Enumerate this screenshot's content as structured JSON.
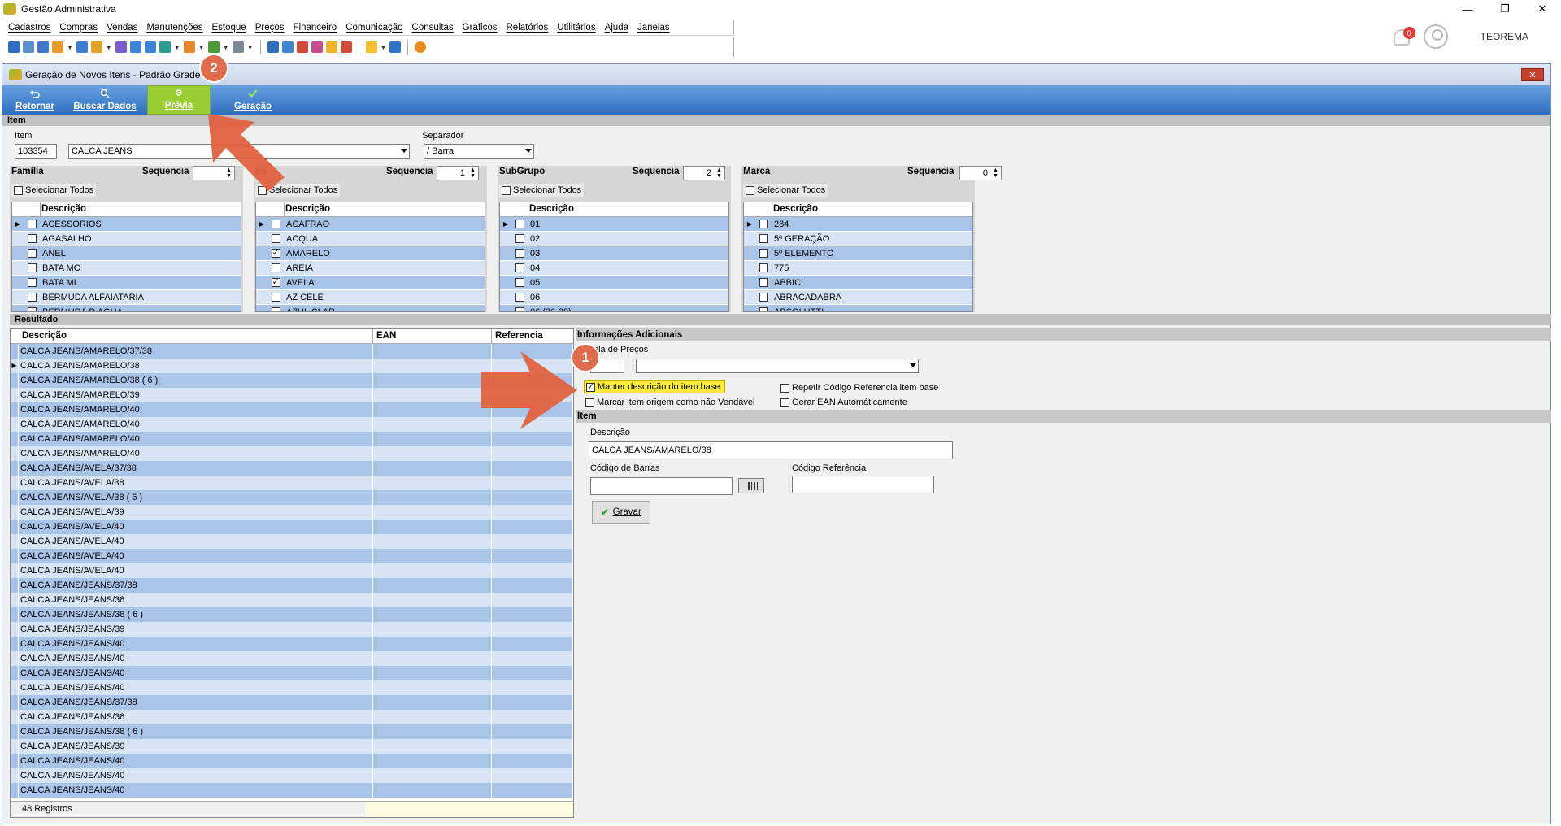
{
  "window": {
    "title": "Gestão Administrativa"
  },
  "menu": [
    "Cadastros",
    "Compras",
    "Vendas",
    "Manutenções",
    "Estoque",
    "Preços",
    "Financeiro",
    "Comunicação",
    "Consultas",
    "Gráficos",
    "Relatórios",
    "Utilitários",
    "Ajuda",
    "Janelas"
  ],
  "notifications": {
    "count": "0"
  },
  "user": {
    "name": "TEOREMA"
  },
  "child": {
    "title": "Geração de Novos Itens - Padrão Grade"
  },
  "ribbon": {
    "retornar": "Retornar",
    "buscar": "Buscar Dados",
    "previa": "Prévia",
    "geracao": "Geração"
  },
  "item_section": {
    "bar": "Item",
    "item_label": "Item",
    "code": "103354",
    "desc": "CALCA JEANS",
    "separador_label": "Separador",
    "separador": "/ Barra"
  },
  "filters": {
    "select_all": "Selecionar Todos",
    "col": "Descrição",
    "seq_label": "Sequencia",
    "familia": {
      "title": "Família",
      "seq": "",
      "rows": [
        {
          "t": "ACESSORIOS",
          "c": false,
          "cur": true
        },
        {
          "t": "AGASALHO",
          "c": false
        },
        {
          "t": "ANEL",
          "c": false
        },
        {
          "t": "BATA MC",
          "c": false
        },
        {
          "t": "BATA ML",
          "c": false
        },
        {
          "t": "BERMUDA ALFAIATARIA",
          "c": false
        },
        {
          "t": "BERMUDA D AGUA",
          "c": false
        }
      ]
    },
    "grupo": {
      "title": "po",
      "seq": "1",
      "rows": [
        {
          "t": "ACAFRAO",
          "c": false,
          "cur": true
        },
        {
          "t": "ACQUA",
          "c": false
        },
        {
          "t": "AMARELO",
          "c": true
        },
        {
          "t": "AREIA",
          "c": false
        },
        {
          "t": "AVELA",
          "c": true
        },
        {
          "t": "AZ CELE",
          "c": false
        },
        {
          "t": "AZUL CLAR",
          "c": false
        }
      ]
    },
    "subgrupo": {
      "title": "SubGrupo",
      "seq": "2",
      "rows": [
        {
          "t": "01",
          "c": false,
          "cur": true
        },
        {
          "t": "02",
          "c": false
        },
        {
          "t": "03",
          "c": false
        },
        {
          "t": "04",
          "c": false
        },
        {
          "t": "05",
          "c": false
        },
        {
          "t": "06",
          "c": false
        },
        {
          "t": "06 (36-38)",
          "c": false
        }
      ]
    },
    "marca": {
      "title": "Marca",
      "seq": "0",
      "rows": [
        {
          "t": "284",
          "c": false,
          "cur": true
        },
        {
          "t": "5ª GERAÇÃO",
          "c": false
        },
        {
          "t": "5º ELEMENTO",
          "c": false
        },
        {
          "t": "775",
          "c": false
        },
        {
          "t": "ABBICI",
          "c": false
        },
        {
          "t": "ABRACADABRA",
          "c": false
        },
        {
          "t": "ABSOLUTTI",
          "c": false
        }
      ]
    }
  },
  "resultado": {
    "bar": "Resultado",
    "headers": [
      "Descrição",
      "EAN",
      "Referencia"
    ],
    "rows": [
      "CALCA JEANS/AMARELO/37/38",
      "CALCA JEANS/AMARELO/38",
      "CALCA JEANS/AMARELO/38 ( 6 )",
      "CALCA JEANS/AMARELO/39",
      "CALCA JEANS/AMARELO/40",
      "CALCA JEANS/AMARELO/40",
      "CALCA JEANS/AMARELO/40",
      "CALCA JEANS/AMARELO/40",
      "CALCA JEANS/AVELA/37/38",
      "CALCA JEANS/AVELA/38",
      "CALCA JEANS/AVELA/38 ( 6 )",
      "CALCA JEANS/AVELA/39",
      "CALCA JEANS/AVELA/40",
      "CALCA JEANS/AVELA/40",
      "CALCA JEANS/AVELA/40",
      "CALCA JEANS/AVELA/40",
      "CALCA JEANS/JEANS/37/38",
      "CALCA JEANS/JEANS/38",
      "CALCA JEANS/JEANS/38 ( 6 )",
      "CALCA JEANS/JEANS/39",
      "CALCA JEANS/JEANS/40",
      "CALCA JEANS/JEANS/40",
      "CALCA JEANS/JEANS/40",
      "CALCA JEANS/JEANS/40",
      "CALCA JEANS/JEANS/37/38",
      "CALCA JEANS/JEANS/38",
      "CALCA JEANS/JEANS/38 ( 6 )",
      "CALCA JEANS/JEANS/39",
      "CALCA JEANS/JEANS/40",
      "CALCA JEANS/JEANS/40",
      "CALCA JEANS/JEANS/40"
    ],
    "current_row": 1,
    "footer": "48 Registros"
  },
  "info": {
    "bar": "Informações Adicionais",
    "tabela_label": "ela de Preços",
    "manter": "Manter descrição do item base",
    "manter_checked": true,
    "marcar": "Marcar item origem como não Vendável",
    "repetir": "Repetir Código Referencia item base",
    "gerar_ean": "Gerar EAN Automáticamente"
  },
  "item_detail": {
    "bar": "Item",
    "desc_label": "Descrição",
    "desc": "CALCA JEANS/AMARELO/38",
    "barras_label": "Código de Barras",
    "ref_label": "Código Referência",
    "gravar": "Gravar"
  },
  "annotations": {
    "one": "1",
    "two": "2"
  }
}
